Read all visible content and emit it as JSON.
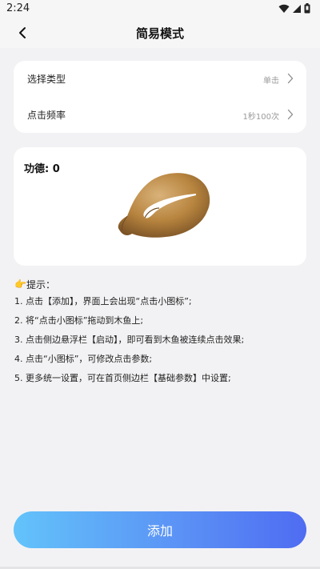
{
  "status_bar": {
    "time": "2:24",
    "icons": [
      "wifi-icon",
      "signal-icon",
      "battery-icon"
    ]
  },
  "header": {
    "title": "简易模式",
    "back_icon": "chevron-left-icon"
  },
  "settings": {
    "items": [
      {
        "label": "选择类型",
        "value": "单击"
      },
      {
        "label": "点击频率",
        "value": "1秒100次"
      }
    ]
  },
  "fish_card": {
    "merit_label": "功德: 0",
    "image": "wooden-fish"
  },
  "tips": {
    "icon": "👉",
    "title": "提示：",
    "lines": [
      "1. 点击【添加】，界面上会出现“点击小图标”;",
      "2. 将“点击小图标”拖动到木鱼上;",
      "3. 点击侧边悬浮栏【启动】，即可看到木鱼被连续点击效果;",
      "4. 点击“小图标”，可修改点击参数;",
      "5. 更多统一设置，可在首页侧边栏【基础参数】中设置;"
    ]
  },
  "add_button": {
    "label": "添加"
  },
  "colors": {
    "background": "#f2f2f4",
    "card": "#ffffff",
    "button_gradient_start": "#63c3fa",
    "button_gradient_end": "#4f6cf2",
    "fish": "#b07a3c"
  }
}
